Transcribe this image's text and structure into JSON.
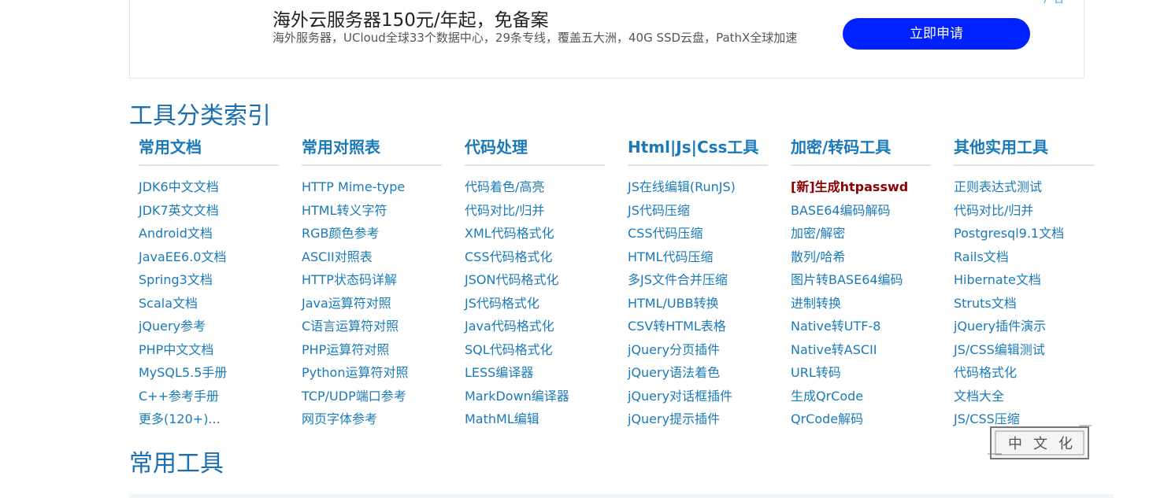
{
  "ad": {
    "title": "海外云服务器150元/年起，免备案",
    "description": "海外服务器，UCloud全球33个数据中心，29条专线，覆盖五大洲，40G SSD云盘，PathX全球加速",
    "button_label": "立即申请",
    "corner_text": "广告"
  },
  "tool_index": {
    "title": "工具分类索引",
    "columns": [
      {
        "heading": "常用文档",
        "items": [
          "JDK6中文文档",
          "JDK7英文文档",
          "Android文档",
          "JavaEE6.0文档",
          "Spring3文档",
          "Scala文档",
          "jQuery参考",
          "PHP中文文档",
          "MySQL5.5手册",
          "C++参考手册",
          "更多(120+)..."
        ]
      },
      {
        "heading": "常用对照表",
        "items": [
          "HTTP Mime-type",
          "HTML转义字符",
          "RGB颜色参考",
          "ASCII对照表",
          "HTTP状态码详解",
          "Java运算符对照",
          "C语言运算符对照",
          "PHP运算符对照",
          "Python运算符对照",
          "TCP/UDP端口参考",
          "网页字体参考"
        ]
      },
      {
        "heading": "代码处理",
        "items": [
          "代码着色/高亮",
          "代码对比/归并",
          "XML代码格式化",
          "CSS代码格式化",
          "JSON代码格式化",
          "JS代码格式化",
          "Java代码格式化",
          "SQL代码格式化",
          "LESS编译器",
          "MarkDown编译器",
          "MathML编辑"
        ]
      },
      {
        "heading": "Html|Js|Css工具",
        "items": [
          "JS在线编辑(RunJS)",
          "JS代码压缩",
          "CSS代码压缩",
          "HTML代码压缩",
          "多JS文件合并压缩",
          "HTML/UBB转换",
          "CSV转HTML表格",
          "jQuery分页插件",
          "jQuery语法着色",
          "jQuery对话框插件",
          "jQuery提示插件"
        ]
      },
      {
        "heading": "加密/转码工具",
        "items": [
          "[新]生成htpasswd",
          "BASE64编码解码",
          "加密/解密",
          "散列/哈希",
          "图片转BASE64编码",
          "进制转换",
          "Native转UTF-8",
          "Native转ASCII",
          "URL转码",
          "生成QrCode",
          "QrCode解码"
        ]
      },
      {
        "heading": "其他实用工具",
        "items": [
          "正则表达式测试",
          "代码对比/归并",
          "Postgresql9.1文档",
          "Rails文档",
          "Hibernate文档",
          "Struts文档",
          "jQuery插件演示",
          "JS/CSS编辑测试",
          "代码格式化",
          "文档大全",
          "JS/CSS压缩"
        ]
      }
    ]
  },
  "common_tools": {
    "title": "常用工具"
  },
  "stamp": {
    "chars": [
      "中",
      "文",
      "化"
    ]
  },
  "colors": {
    "link": "#1a7ab8",
    "heading": "#1a6fb0",
    "hot": "#8b0000",
    "button": "#0022ff"
  }
}
